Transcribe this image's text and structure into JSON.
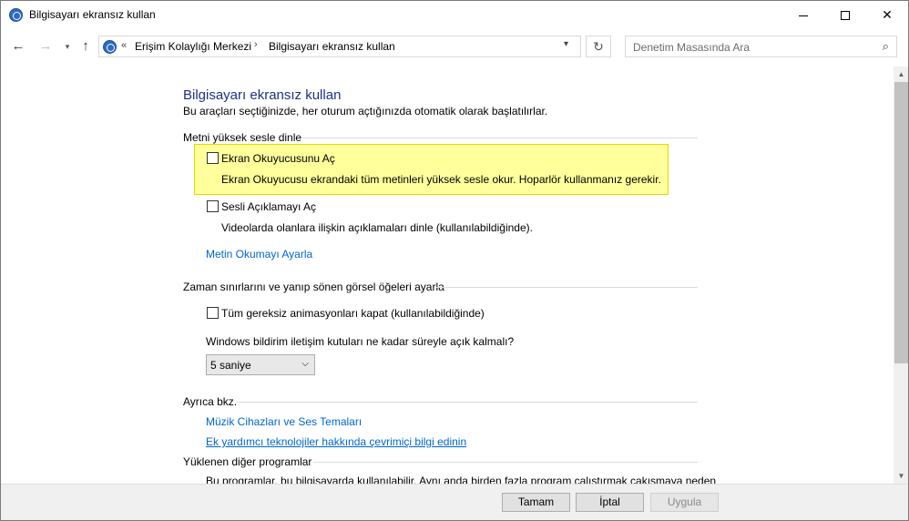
{
  "window": {
    "title": "Bilgisayarı ekransız kullan"
  },
  "navigation": {
    "back_icon": "arrow-left",
    "forward_icon": "arrow-right",
    "recent_icon": "chevron-down",
    "up_icon": "arrow-up"
  },
  "address": {
    "overflow_chevrons": "«",
    "crumb1": "Erişim Kolaylığı Merkezi",
    "separator": "›",
    "crumb2": "Bilgisayarı ekransız kullan"
  },
  "search": {
    "placeholder": "Denetim Masasında Ara"
  },
  "page": {
    "title": "Bilgisayarı ekransız kullan",
    "subtitle": "Bu araçları seçtiğinizde, her oturum açtığınızda otomatik olarak başlatılırlar."
  },
  "sections": {
    "tts": {
      "heading": "Metni yüksek sesle dinle",
      "narrator_label": "Ekran Okuyucusunu Aç",
      "narrator_checked": false,
      "narrator_desc": "Ekran Okuyucusu ekrandaki tüm metinleri yüksek sesle okur. Hoparlör kullanmanız gerekir.",
      "ad_label": "Sesli Açıklamayı Aç",
      "ad_checked": false,
      "ad_desc": "Videolarda olanlara ilişkin açıklamaları dinle (kullanılabildiğinde).",
      "settings_link": "Metin Okumayı Ayarla"
    },
    "time": {
      "heading": "Zaman sınırlarını ve yanıp sönen görsel öğeleri ayarla",
      "anim_label": "Tüm gereksiz animasyonları kapat (kullanılabildiğinde)",
      "anim_checked": false,
      "notif_question": "Windows bildirim iletişim kutuları ne kadar süreyle açık kalmalı?",
      "notif_value": "5 saniye"
    },
    "see_also": {
      "heading": "Ayrıca bkz.",
      "link1": "Müzik Cihazları ve Ses Temaları",
      "link2": "Ek yardımcı teknolojiler hakkında çevrimiçi bilgi edinin"
    },
    "installed": {
      "heading": "Yüklenen diğer programlar",
      "partial_text": "Bu programlar, bu bilgisayarda kullanılabilir. Aynı anda birden fazla program çalıştırmak çakışmaya neden"
    }
  },
  "buttons": {
    "ok": "Tamam",
    "cancel": "İptal",
    "apply": "Uygula"
  }
}
